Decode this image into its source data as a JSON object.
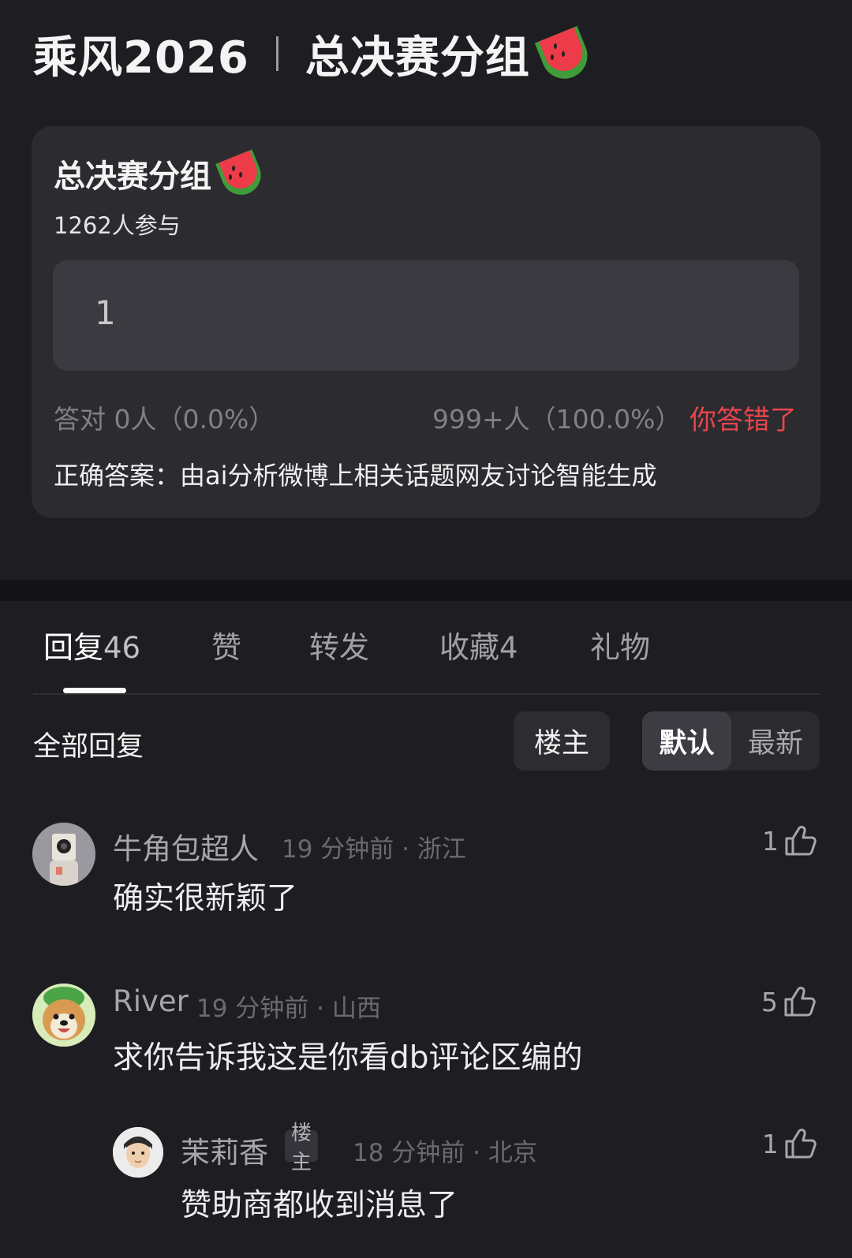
{
  "post": {
    "title_left": "乘风2026",
    "title_right": "总决赛分组"
  },
  "quiz": {
    "title": "总决赛分组",
    "participants": "1262人参与",
    "option_text": "1",
    "correct_stat": "答对 0人（0.0%）",
    "wrong_stat": "999+人（100.0%）",
    "result": "你答错了",
    "answer": "正确答案：由ai分析微博上相关话题网友讨论智能生成"
  },
  "tabs": [
    {
      "label": "回复",
      "count": "46"
    },
    {
      "label": "赞",
      "count": ""
    },
    {
      "label": "转发",
      "count": ""
    },
    {
      "label": "收藏",
      "count": "4"
    },
    {
      "label": "礼物",
      "count": ""
    }
  ],
  "filter": {
    "all_label": "全部回复",
    "op_label": "楼主",
    "default_label": "默认",
    "latest_label": "最新"
  },
  "comments": [
    {
      "name": "牛角包超人",
      "meta": "19 分钟前 · 浙江",
      "body": "确实很新颖了",
      "likes": "1"
    },
    {
      "name": "River",
      "meta": "19 分钟前 · 山西",
      "body": "求你告诉我这是你看db评论区编的",
      "likes": "5"
    },
    {
      "name": "茉莉香",
      "tag": "楼主",
      "meta": "18 分钟前 · 北京",
      "body": "赞助商都收到消息了",
      "likes": "1"
    }
  ],
  "colors": {
    "background": "#1e1e22",
    "card": "#2b2b30",
    "wrong_red": "#e8454d"
  }
}
